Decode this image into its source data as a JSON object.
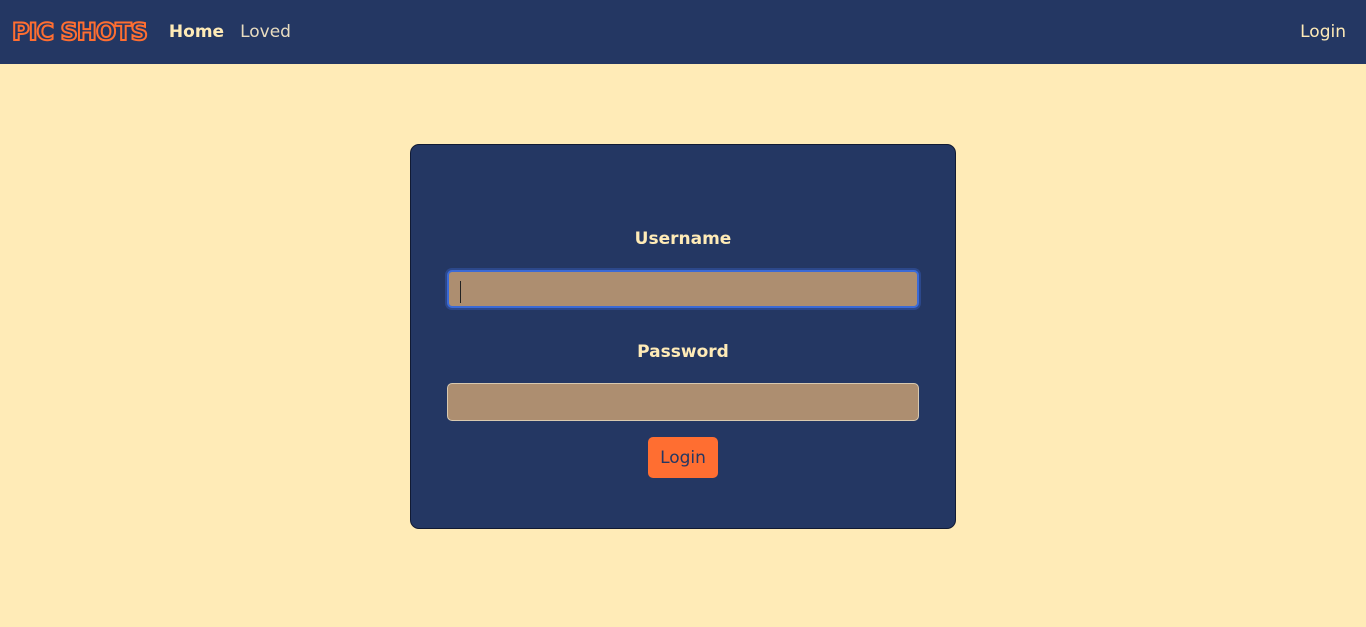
{
  "navbar": {
    "brand": "PIC SHOTS",
    "links": [
      {
        "label": "Home",
        "active": true
      },
      {
        "label": "Loved",
        "active": false
      }
    ],
    "right_link": "Login"
  },
  "login_form": {
    "username_label": "Username",
    "username_value": "",
    "password_label": "Password",
    "password_value": "",
    "submit_label": "Login"
  },
  "colors": {
    "navbar_bg": "#243763",
    "page_bg": "#ffebb7",
    "accent": "#ff6e31",
    "input_bg": "#ad8e70",
    "text_light": "#ffebb7"
  }
}
